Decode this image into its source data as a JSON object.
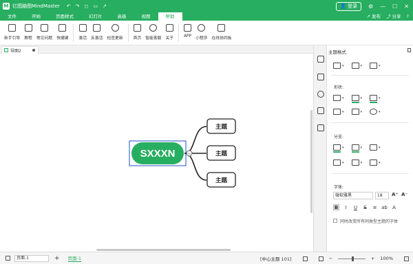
{
  "titlebar": {
    "app_title": "亿图脑图MindMaster",
    "logo_letter": "M",
    "quick_access": [
      "↶",
      "↷",
      "◻",
      "▭",
      "↗"
    ],
    "login_label": "登录",
    "window_controls": [
      "⚙",
      "—",
      "☐",
      "✕"
    ]
  },
  "menu": {
    "items": [
      "文件",
      "开始",
      "页面样式",
      "幻灯片",
      "高级",
      "视图",
      "帮助"
    ],
    "active_index": 6,
    "publish_label": "发布",
    "share_label": "分享",
    "help_icon": "?"
  },
  "ribbon": {
    "groups": [
      [
        {
          "label": "新手引导",
          "icon": "guide-icon"
        },
        {
          "label": "教程",
          "icon": "tutorial-icon"
        },
        {
          "label": "常见问题",
          "icon": "faq-icon"
        },
        {
          "label": "快捷键",
          "icon": "shortcut-icon"
        }
      ],
      [
        {
          "label": "激活",
          "icon": "activate-icon"
        },
        {
          "label": "反激活",
          "icon": "deactivate-icon"
        },
        {
          "label": "检查更新",
          "icon": "update-icon"
        }
      ],
      [
        {
          "label": "首页",
          "icon": "home-icon"
        },
        {
          "label": "智能客服",
          "icon": "service-icon"
        },
        {
          "label": "关于",
          "icon": "about-icon"
        }
      ],
      [
        {
          "label": "APP",
          "icon": "app-icon"
        },
        {
          "label": "小程序",
          "icon": "miniprogram-icon"
        },
        {
          "label": "在线协同板",
          "icon": "whiteboard-icon"
        }
      ]
    ]
  },
  "document": {
    "tab_label": "导图2"
  },
  "mindmap": {
    "central_topic": "SXXXN",
    "subtopics": [
      "主题",
      "主题",
      "主题"
    ],
    "collapse_symbol": "−",
    "accent_color": "#27ae60",
    "selection_color": "#1e50c8"
  },
  "panel": {
    "title": "主题格式",
    "shape_label": "形状:",
    "branch_label": "分支:",
    "font_label": "字体:",
    "font_name": "微软雅黑",
    "font_size": "18",
    "grow_font": "A⁺",
    "shrink_font": "A⁻",
    "format_buttons": [
      "B",
      "I",
      "U",
      "S",
      "≡",
      "ab",
      "A"
    ],
    "checkbox_label": "同时改变所有同类型主题的字体"
  },
  "statusbar": {
    "page_select": "页面-1",
    "add_page": "+",
    "page_tab": "页面-1",
    "central_info": "[中心主题 101]",
    "zoom": "100%",
    "zoom_level": 0.5
  }
}
